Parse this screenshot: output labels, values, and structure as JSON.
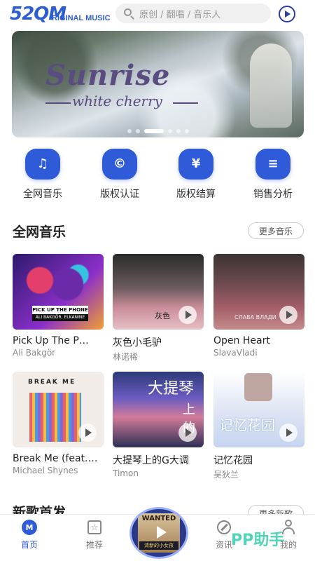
{
  "header": {
    "logo_main": "52QM",
    "logo_sub": "RIGINAL MUSIC",
    "search_placeholder": "原创 / 翻唱 / 音乐人"
  },
  "banner": {
    "title": "Sunrise",
    "subtitle": "white cherry",
    "page_count": 6,
    "active_page": 2
  },
  "quick_nav": [
    {
      "label": "全网音乐",
      "icon": "music-note-icon",
      "glyph": "♫"
    },
    {
      "label": "版权认证",
      "icon": "copyright-shield-icon",
      "glyph": "©"
    },
    {
      "label": "版权结算",
      "icon": "yen-card-icon",
      "glyph": "¥"
    },
    {
      "label": "销售分析",
      "icon": "report-icon",
      "glyph": "≡"
    }
  ],
  "section": {
    "title": "全网音乐",
    "more_label": "更多音乐"
  },
  "songs": [
    {
      "title": "Pick Up The P…",
      "artist": "Ali Bakgör",
      "cover_text": "PICK UP THE PHONE",
      "cover_sub": "ALI BAKGÖR, ELKANINE"
    },
    {
      "title": "灰色小毛驴",
      "artist": "林诺稀",
      "cover_text": "灰色"
    },
    {
      "title": "Open Heart",
      "artist": "SlavaVladi",
      "cover_text": "СЛАВА ВЛАДИ"
    },
    {
      "title": "Break Me (feat.…",
      "artist": "Michael Shynes",
      "cover_text": "BREAK ME"
    },
    {
      "title": "大提琴上的G大调",
      "artist": "Timon",
      "cover_text": "大提琴",
      "cover_text2": "上的"
    },
    {
      "title": "记忆花园",
      "artist": "吴狄兰",
      "cover_text": "记忆花园"
    }
  ],
  "next_section": {
    "title": "新歌首发",
    "more_label": "更多新歌"
  },
  "bottom_nav": [
    {
      "label": "首页",
      "icon": "home-icon",
      "active": true
    },
    {
      "label": "推荐",
      "icon": "star-icon",
      "active": false
    },
    {
      "label": "资讯",
      "icon": "compass-icon",
      "active": false
    },
    {
      "label": "我的",
      "icon": "user-icon",
      "active": false
    }
  ],
  "now_playing": {
    "poster_top": "WANTED",
    "poster_bottom": "清新的小女孩"
  },
  "watermark": "PP助手",
  "colors": {
    "accent": "#2f5bd8",
    "text_primary": "#222222",
    "text_secondary": "#888888"
  }
}
